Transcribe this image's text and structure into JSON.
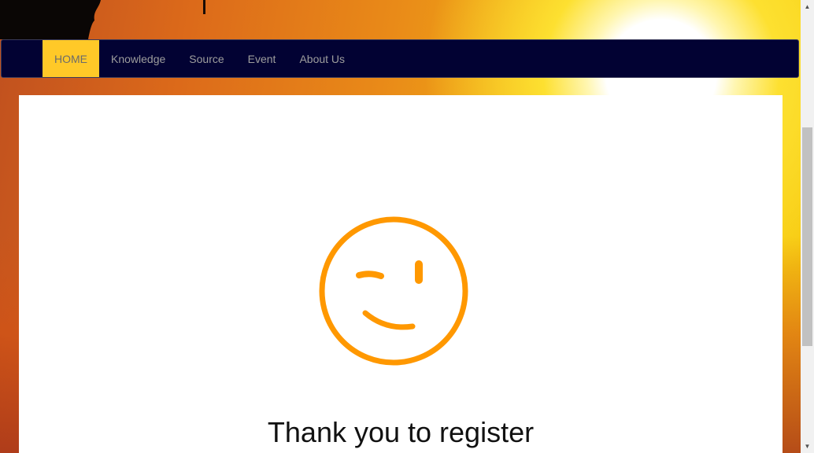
{
  "navbar": {
    "items": [
      {
        "label": "HOME",
        "active": true
      },
      {
        "label": "Knowledge",
        "active": false
      },
      {
        "label": "Source",
        "active": false
      },
      {
        "label": "Event",
        "active": false
      },
      {
        "label": "About Us",
        "active": false
      }
    ],
    "active_color": "#ffc928",
    "background_color": "#020233"
  },
  "main": {
    "icon": "winking-face-icon",
    "icon_color": "#ff9800",
    "message": "Thank you to register"
  },
  "scrollbar": {
    "up_arrow": "▲",
    "down_arrow": "▼"
  }
}
